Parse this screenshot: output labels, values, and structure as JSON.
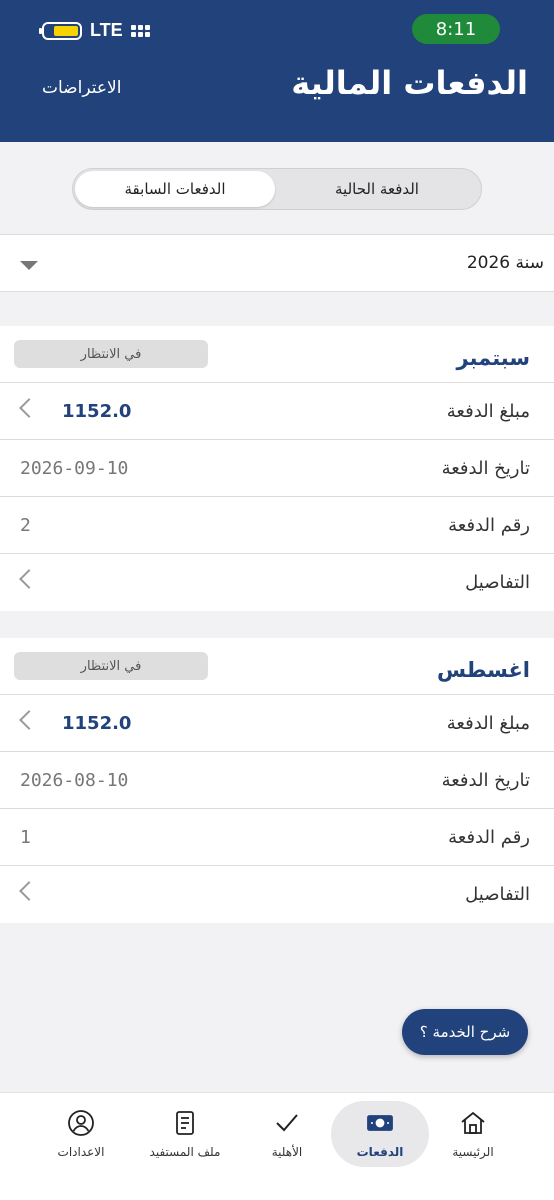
{
  "status": {
    "time": "8:11",
    "network": "LTE"
  },
  "header": {
    "title": "الدفعات المالية",
    "objections": "الاعتراضات"
  },
  "tabs": {
    "current": "الدفعة الحالية",
    "previous": "الدفعات السابقة"
  },
  "year_select": {
    "value": "سنة 2026"
  },
  "labels": {
    "amount": "مبلغ الدفعة",
    "date": "تاريخ الدفعة",
    "number": "رقم الدفعة",
    "details": "التفاصيل"
  },
  "payments": [
    {
      "month": "سبتمبر",
      "status": "في الانتظار",
      "amount": "1152.0",
      "date": "2026-09-10",
      "number": "2"
    },
    {
      "month": "اغسطس",
      "status": "في الانتظار",
      "amount": "1152.0",
      "date": "2026-08-10",
      "number": "1"
    }
  ],
  "help_button": "شرح الخدمة ؟",
  "nav": {
    "settings": "الاعدادات",
    "profile": "ملف المستفيد",
    "eligibility": "الأهلية",
    "payments": "الدفعات",
    "home": "الرئيسية"
  },
  "colors": {
    "primary": "#21427a",
    "status_green": "#1f8a3a",
    "battery": "#f5d400"
  },
  "icons": [
    "battery-icon",
    "signal-icon",
    "chevron-left-icon",
    "caret-down-icon",
    "user-circle-icon",
    "document-icon",
    "check-icon",
    "cash-icon",
    "home-icon"
  ]
}
